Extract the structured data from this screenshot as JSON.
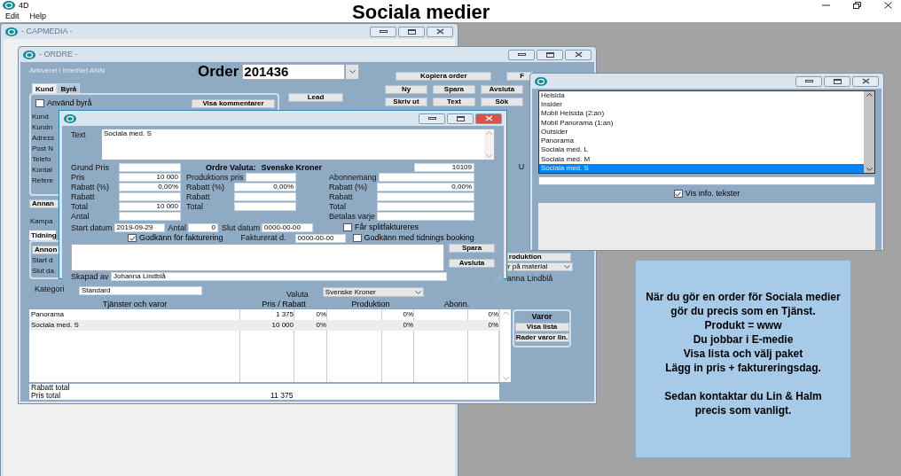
{
  "app": {
    "title": "4D",
    "menu": [
      "Edit",
      "Help"
    ]
  },
  "heading": "Sociala medier",
  "capmedia_window": {
    "title": "- CAPMEDIA -"
  },
  "order_window": {
    "title": "- ORDRE -",
    "archive_note": "Arkiveret i InterNet ANN",
    "order_label": "Order",
    "order_number": "201436",
    "top_buttons": [
      "Kopiera order",
      "F"
    ],
    "tabs": [
      {
        "label": "Kund",
        "selected": true
      },
      {
        "label": "Byrå",
        "selected": false
      }
    ],
    "use_agency": {
      "label": "Använd byrå",
      "checked": false
    },
    "comments_button": "Visa kommentarer",
    "lead_button": "Lead",
    "action_buttons": [
      "Ny",
      "Spara",
      "Avsluta",
      "Skriv ut",
      "Text",
      "Sök"
    ],
    "customer_labels": [
      "Kund",
      "Kundn",
      "Adress",
      "Post N",
      "Telefo",
      "Kontal",
      "Refere"
    ],
    "other_button": "Annan",
    "campaign_label": "Kampa",
    "lower_tab": "Tidning",
    "ad_button": "Annon",
    "date_labels": [
      "Start d",
      "Slut da"
    ],
    "category": {
      "label": "Kategori",
      "value": "Standard"
    },
    "right_edge": {
      "label": "U",
      "production_button": "roduktion",
      "material_select": "r på material",
      "creator": "anna Lindblå"
    },
    "currency": {
      "label": "Valuta",
      "value": "Svenske Kroner"
    },
    "table": {
      "columns": [
        "Tjänster och varor",
        "Pris / Rabatt",
        "Produktion",
        "Abonn."
      ],
      "rows": [
        {
          "name": "Panorama",
          "price": "1 375",
          "price_discount": "0%",
          "production_discount": "0%",
          "subscription_discount": "0%"
        },
        {
          "name": "Sociala med. S",
          "price": "10 000",
          "price_discount": "0%",
          "production_discount": "0%",
          "subscription_discount": "0%"
        }
      ]
    },
    "totals": [
      {
        "label": "Rabatt total"
      },
      {
        "label": "Pris total",
        "value": "11 375"
      }
    ],
    "goods": {
      "title": "Varor",
      "buttons": [
        "Visa lista",
        "Rader varor lin."
      ]
    }
  },
  "item_dialog": {
    "text_label": "Text",
    "text_value": "Sociala med. S",
    "currency_label": "Ordre Valuta:",
    "currency_value": "Svenske Kroner",
    "record_number": "10109",
    "price_columns": [
      [
        {
          "label": "Grund Pris"
        },
        {
          "label": "Pris",
          "value": "10 000"
        },
        {
          "label": "Rabatt (%)",
          "value": "0,00%"
        },
        {
          "label": "Rabatt"
        },
        {
          "label": "Total",
          "value": "10 000"
        },
        {
          "label": "Antal"
        }
      ],
      [
        {
          "label": "Produktions pris"
        },
        {
          "label": "Rabatt (%)",
          "value": "0,00%"
        },
        {
          "label": "Rabatt"
        },
        {
          "label": "Total"
        }
      ],
      [
        {
          "label": "Abonnemang"
        },
        {
          "label": "Rabatt (%)",
          "value": "0,00%"
        },
        {
          "label": "Rabatt"
        },
        {
          "label": "Total"
        },
        {
          "label": "Betalas varje"
        }
      ]
    ],
    "dates": [
      {
        "label": "Start datum",
        "value": "2019-09-29"
      },
      {
        "label": "Antal",
        "value": "0"
      },
      {
        "label": "Slut datum",
        "value": "0000-00-00"
      }
    ],
    "invoice_date": {
      "label": "Fakturerat d.",
      "value": "0000-00-00"
    },
    "checkboxes": [
      {
        "label": "Får splitfaktureres",
        "checked": false
      },
      {
        "label": "Godkänn för fakturering",
        "checked": true
      },
      {
        "label": "Godkänn med tidnings booking",
        "checked": false
      }
    ],
    "buttons": [
      "Spara",
      "Avsluta"
    ],
    "creator_label": "Skapad av",
    "creator": "Johanna Lindblå"
  },
  "product_window": {
    "items": [
      {
        "label": "Helsida",
        "selected": false
      },
      {
        "label": "Insider",
        "selected": false
      },
      {
        "label": "Mobil Helsida (2:an)",
        "selected": false
      },
      {
        "label": "Mobil Panorama (1:an)",
        "selected": false
      },
      {
        "label": "Outsider",
        "selected": false
      },
      {
        "label": "Panorama",
        "selected": false
      },
      {
        "label": "Sociala med. L",
        "selected": false
      },
      {
        "label": "Sociala med. M",
        "selected": false
      },
      {
        "label": "Sociala med. S",
        "selected": true
      }
    ],
    "info_checkbox": {
      "label": "Vis info. tekster",
      "checked": true
    }
  },
  "info_box": {
    "paragraphs": [
      "När du gör en order för Sociala medier gör du precis som en Tjänst.",
      "Produkt = www",
      "Du jobbar i E-medie",
      "Visa lista och välj paket",
      "Lägg in pris + faktureringsdag."
    ],
    "footer": "Sedan kontaktar du Lin & Halm precis som vanligt."
  }
}
